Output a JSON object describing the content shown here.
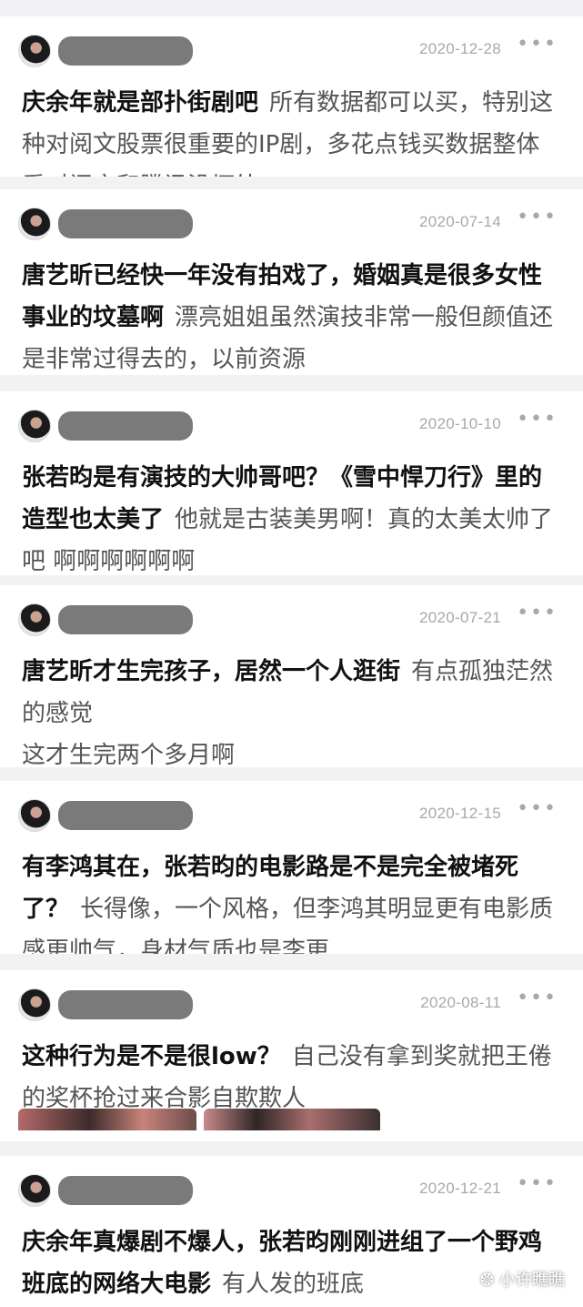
{
  "posts": [
    {
      "date": "2020-12-28",
      "title": "庆余年就是部扑街剧吧",
      "body": "所有数据都可以买，特别这种对阅文股票很重要的IP剧，多花点钱买数据整体看对阅文和腾讯没坏处"
    },
    {
      "date": "2020-07-14",
      "title": "唐艺昕已经快一年没有拍戏了，婚姻真是很多女性事业的坟墓啊",
      "body": "漂亮姐姐虽然演技非常一般但颜值还是非常过得去的，以前资源"
    },
    {
      "date": "2020-10-10",
      "title": "张若昀是有演技的大帅哥吧？《雪中悍刀行》里的造型也太美了",
      "body": "他就是古装美男啊！真的太美太帅了吧 啊啊啊啊啊啊"
    },
    {
      "date": "2020-07-21",
      "title": "唐艺昕才生完孩子，居然一个人逛街",
      "body": "有点孤独茫然的感觉",
      "body2": "这才生完两个多月啊"
    },
    {
      "date": "2020-12-15",
      "title": "有李鸿其在，张若昀的电影路是不是完全被堵死了？",
      "body": "长得像，一个风格，但李鸿其明显更有电影质感更帅气，身材气质也是李更"
    },
    {
      "date": "2020-08-11",
      "title": "这种行为是不是很low？",
      "body": "自己没有拿到奖就把王倦的奖杯抢过来合影自欺欺人"
    },
    {
      "date": "2020-12-21",
      "title": "庆余年真爆剧不爆人，张若昀刚刚进组了一个野鸡班底的网络大电影",
      "body": "有人发的班底"
    }
  ],
  "more_icon": "•••",
  "watermark": "小许瞧瞧",
  "icons": {
    "avatar": "avatar-photo",
    "more": "more-dots-icon",
    "watermark": "wechat-icon"
  },
  "colors": {
    "background": "#f2f2f4",
    "card": "#ffffff",
    "title": "#111111",
    "body": "#555555",
    "date": "#a8a8a8",
    "name_mask": "#7a7a7a"
  }
}
